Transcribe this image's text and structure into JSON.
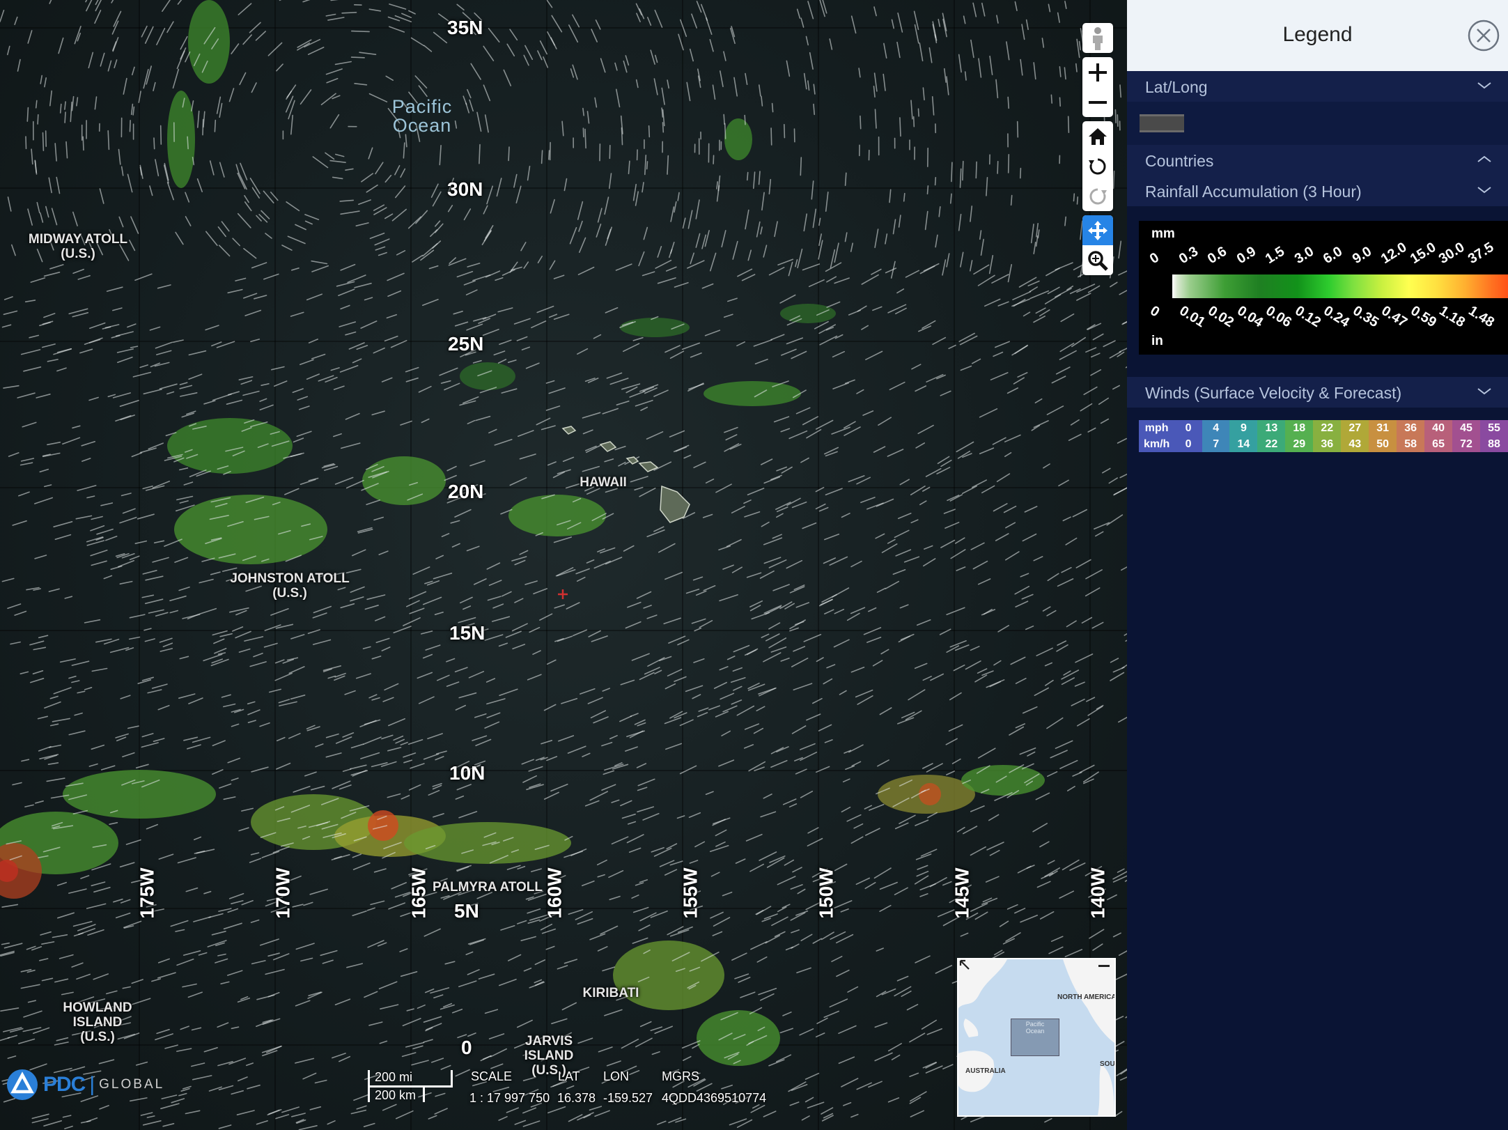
{
  "map": {
    "ocean_label": [
      "Pacific",
      "Ocean"
    ],
    "latitudes": [
      "35N",
      "30N",
      "25N",
      "20N",
      "15N",
      "10N",
      "5N",
      "0"
    ],
    "longitudes": [
      "175W",
      "170W",
      "165W",
      "160W",
      "155W",
      "150W",
      "145W",
      "140W"
    ],
    "places": {
      "midway": [
        "MIDWAY ATOLL",
        "(U.S.)"
      ],
      "hawaii": [
        "HAWAII"
      ],
      "johnston": [
        "JOHNSTON ATOLL",
        "(U.S.)"
      ],
      "palmyra": [
        "PALMYRA ATOLL"
      ],
      "kiribati": [
        "KIRIBATI"
      ],
      "howland": [
        "HOWLAND",
        "ISLAND",
        "(U.S.)"
      ],
      "jarvis": [
        "JARVIS",
        "ISLAND",
        "(U.S.)"
      ]
    }
  },
  "toolbar": {
    "icons": [
      "street-view-icon",
      "zoom-in-icon",
      "zoom-out-icon",
      "home-icon",
      "rotate-left-icon",
      "rotate-right-icon",
      "pan-icon",
      "zoom-box-icon"
    ],
    "active": "pan-icon"
  },
  "logo": {
    "brand": "PDC",
    "global": "GLOBAL"
  },
  "scale": {
    "miles": "200 mi",
    "km": "200 km"
  },
  "readout": {
    "scale_label": "SCALE",
    "scale_value": "1 : 17 997 750",
    "lat_label": "LAT",
    "lat_value": "16.378",
    "lon_label": "LON",
    "lon_value": "-159.527",
    "mgrs_label": "MGRS",
    "mgrs_value": "4QDD4369510774"
  },
  "minimap": {
    "north_america": "NORTH AMERICA",
    "australia": "AUSTRALIA",
    "south": "SOU",
    "extent_label": [
      "Pacific",
      "Ocean"
    ]
  },
  "legend": {
    "title": "Legend",
    "sections": {
      "latlong": "Lat/Long",
      "countries": "Countries",
      "rainfall": "Rainfall Accumulation (3 Hour)",
      "winds": "Winds (Surface Velocity & Forecast)"
    },
    "rainfall": {
      "unit_top": "mm",
      "unit_bottom": "in",
      "mm_ticks": [
        "0",
        "0.3",
        "0.6",
        "0.9",
        "1.5",
        "3.0",
        "6.0",
        "9.0",
        "12.0",
        "15.0",
        "30.0",
        "37.5"
      ],
      "in_ticks": [
        "0",
        "0.01",
        "0.02",
        "0.04",
        "0.06",
        "0.12",
        "0.24",
        "0.35",
        "0.47",
        "0.59",
        "1.18",
        "1.48"
      ]
    },
    "winds": {
      "row1_unit": "mph",
      "row2_unit": "km/h",
      "mph": [
        "0",
        "4",
        "9",
        "13",
        "18",
        "22",
        "27",
        "31",
        "36",
        "40",
        "45",
        "55"
      ],
      "kmh": [
        "0",
        "7",
        "14",
        "22",
        "29",
        "36",
        "43",
        "50",
        "58",
        "65",
        "72",
        "88"
      ],
      "colors": [
        "#4a58b8",
        "#3e86b8",
        "#35a0a0",
        "#3caa78",
        "#55b050",
        "#88b040",
        "#b0a838",
        "#c89040",
        "#c87858",
        "#b8607a",
        "#a25090",
        "#8a4aa0"
      ]
    },
    "colors": {
      "header_bg": "#eef3f8",
      "panel_bg": "#0a1434",
      "section_bg": "#14204a",
      "accent": "#2684e6"
    }
  }
}
